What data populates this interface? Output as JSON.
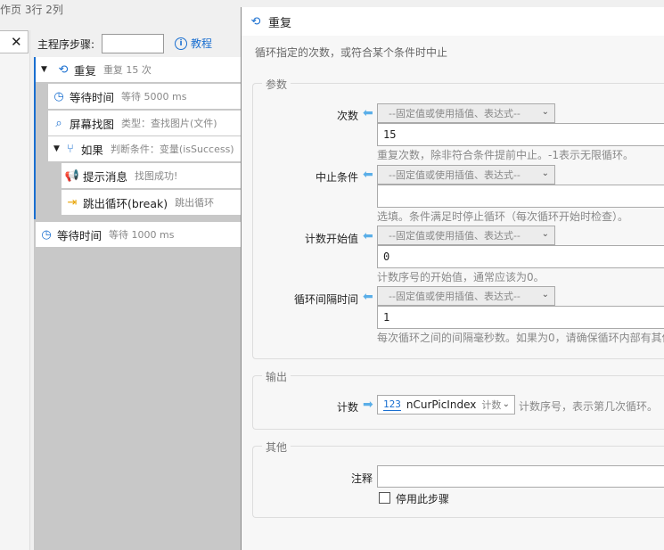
{
  "crumb": "作页 3行 2列",
  "left_close": "✕",
  "main": {
    "steps_label": "主程序步骤:",
    "tutorial": "教程"
  },
  "tree": [
    {
      "name": "重复",
      "desc": "重复 15 次",
      "icon": "loop-icon"
    },
    {
      "name": "等待时间",
      "desc": "等待 5000 ms",
      "icon": "timer-icon"
    },
    {
      "name": "屏幕找图",
      "desc": "类型：查找图片(文件)",
      "icon": "find-image-icon"
    },
    {
      "name": "如果",
      "desc": "判断条件：变量(isSuccess)",
      "icon": "branch-icon"
    },
    {
      "name": "提示消息",
      "desc": "找图成功!",
      "icon": "message-icon"
    },
    {
      "name": "跳出循环(break)",
      "desc": "跳出循环",
      "icon": "exit-icon"
    },
    {
      "name": "等待时间",
      "desc": "等待 1000 ms",
      "icon": "timer-icon"
    }
  ],
  "dialog": {
    "title": "重复",
    "description": "循环指定的次数，或符合某个条件时中止",
    "params_title": "参数",
    "combo_placeholder": "--固定值或使用插值、表达式--",
    "params": [
      {
        "label": "次数",
        "value": "15",
        "hint": "重复次数，除非符合条件提前中止。-1表示无限循环。"
      },
      {
        "label": "中止条件",
        "value": "",
        "hint": "选填。条件满足时停止循环（每次循环开始时检查）。"
      },
      {
        "label": "计数开始值",
        "value": "0",
        "hint": "计数序号的开始值，通常应该为0。"
      },
      {
        "label": "循环间隔时间",
        "value": "1",
        "hint": "每次循环之间的间隔毫秒数。如果为0，请确保循环内部有其他"
      }
    ],
    "output_title": "输出",
    "output": {
      "label": "计数",
      "var_icon": "123",
      "var_name": "nCurPicIndex",
      "var_type": "计数",
      "hint": "计数序号，表示第几次循环。"
    },
    "other_title": "其他",
    "note_label": "注释",
    "disable_label": "停用此步骤"
  }
}
